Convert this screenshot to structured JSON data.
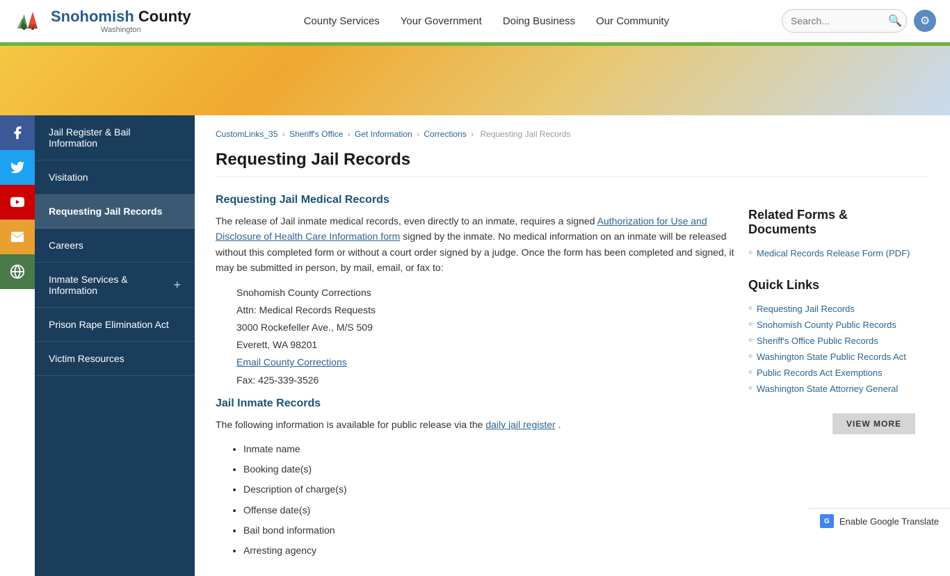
{
  "header": {
    "logo_main": "Snohomish County",
    "logo_sub": "Washington",
    "nav": [
      {
        "label": "County Services"
      },
      {
        "label": "Your Government"
      },
      {
        "label": "Doing Business"
      },
      {
        "label": "Our Community"
      }
    ],
    "search_placeholder": "Search..."
  },
  "left_nav": {
    "items": [
      {
        "id": "jail-register",
        "label": "Jail Register & Bail Information",
        "has_plus": false
      },
      {
        "id": "visitation",
        "label": "Visitation",
        "has_plus": false
      },
      {
        "id": "requesting-jail-records",
        "label": "Requesting Jail Records",
        "has_plus": false,
        "active": true
      },
      {
        "id": "careers",
        "label": "Careers",
        "has_plus": false
      },
      {
        "id": "inmate-services",
        "label": "Inmate Services & Information",
        "has_plus": true
      },
      {
        "id": "prison-rape",
        "label": "Prison Rape Elimination Act",
        "has_plus": false
      },
      {
        "id": "victim-resources",
        "label": "Victim Resources",
        "has_plus": false
      }
    ]
  },
  "breadcrumb": {
    "items": [
      {
        "label": "CustomLinks_35",
        "href": "#"
      },
      {
        "label": "Sheriff's Office",
        "href": "#"
      },
      {
        "label": "Get Information",
        "href": "#"
      },
      {
        "label": "Corrections",
        "href": "#"
      },
      {
        "label": "Requesting Jail Records",
        "href": null
      }
    ]
  },
  "page": {
    "title": "Requesting Jail Records",
    "section1_title": "Requesting Jail Medical Records",
    "section1_para1": "The release of Jail inmate medical records, even directly to an inmate, requires a signed",
    "section1_link": "Authorization for Use and Disclosure of Health Care Information form",
    "section1_para2": " signed by the inmate. No medical information on an inmate will be released without this completed form or without a court order signed by a judge. Once the form has been completed and signed, it may be submitted in person, by mail, email, or fax to:",
    "address": {
      "line1": "Snohomish County Corrections",
      "line2": "Attn: Medical Records Requests",
      "line3": "3000 Rockefeller Ave., M/S 509",
      "line4": "Everett, WA 98201",
      "email_label": "Email County Corrections",
      "fax": "Fax: 425-339-3526"
    },
    "section2_title": "Jail Inmate Records",
    "section2_para": "The following information is available for public release via the",
    "section2_link": "daily jail register",
    "section2_link_suffix": ".",
    "bullet_items": [
      "Inmate name",
      "Booking date(s)",
      "Description of charge(s)",
      "Offense date(s)",
      "Bail bond information",
      "Arresting agency"
    ]
  },
  "sidebar": {
    "forms_title": "Related Forms & Documents",
    "forms_items": [
      {
        "label": "Medical Records Release Form (PDF)",
        "href": "#"
      }
    ],
    "quick_links_title": "Quick Links",
    "quick_links": [
      {
        "label": "Requesting Jail Records",
        "href": "#"
      },
      {
        "label": "Snohomish County Public Records",
        "href": "#"
      },
      {
        "label": "Sheriff's Office Public Records",
        "href": "#"
      },
      {
        "label": "Washington State Public Records Act",
        "href": "#"
      },
      {
        "label": "Public Records Act Exemptions",
        "href": "#"
      },
      {
        "label": "Washington State Attorney General",
        "href": "#"
      }
    ],
    "view_more_label": "VIEW MORE"
  },
  "social_icons": [
    {
      "id": "facebook",
      "symbol": "f",
      "label": "facebook-icon",
      "color": "#3b5998"
    },
    {
      "id": "twitter",
      "symbol": "t",
      "label": "twitter-icon",
      "color": "#1da1f2"
    },
    {
      "id": "youtube",
      "symbol": "▶",
      "label": "youtube-icon",
      "color": "#cc0000"
    },
    {
      "id": "email",
      "symbol": "@",
      "label": "email-icon",
      "color": "#e8a030"
    },
    {
      "id": "globe",
      "symbol": "⊕",
      "label": "globe-icon",
      "color": "#5a8a5a"
    }
  ],
  "google_translate": {
    "label": "Enable Google Translate"
  }
}
